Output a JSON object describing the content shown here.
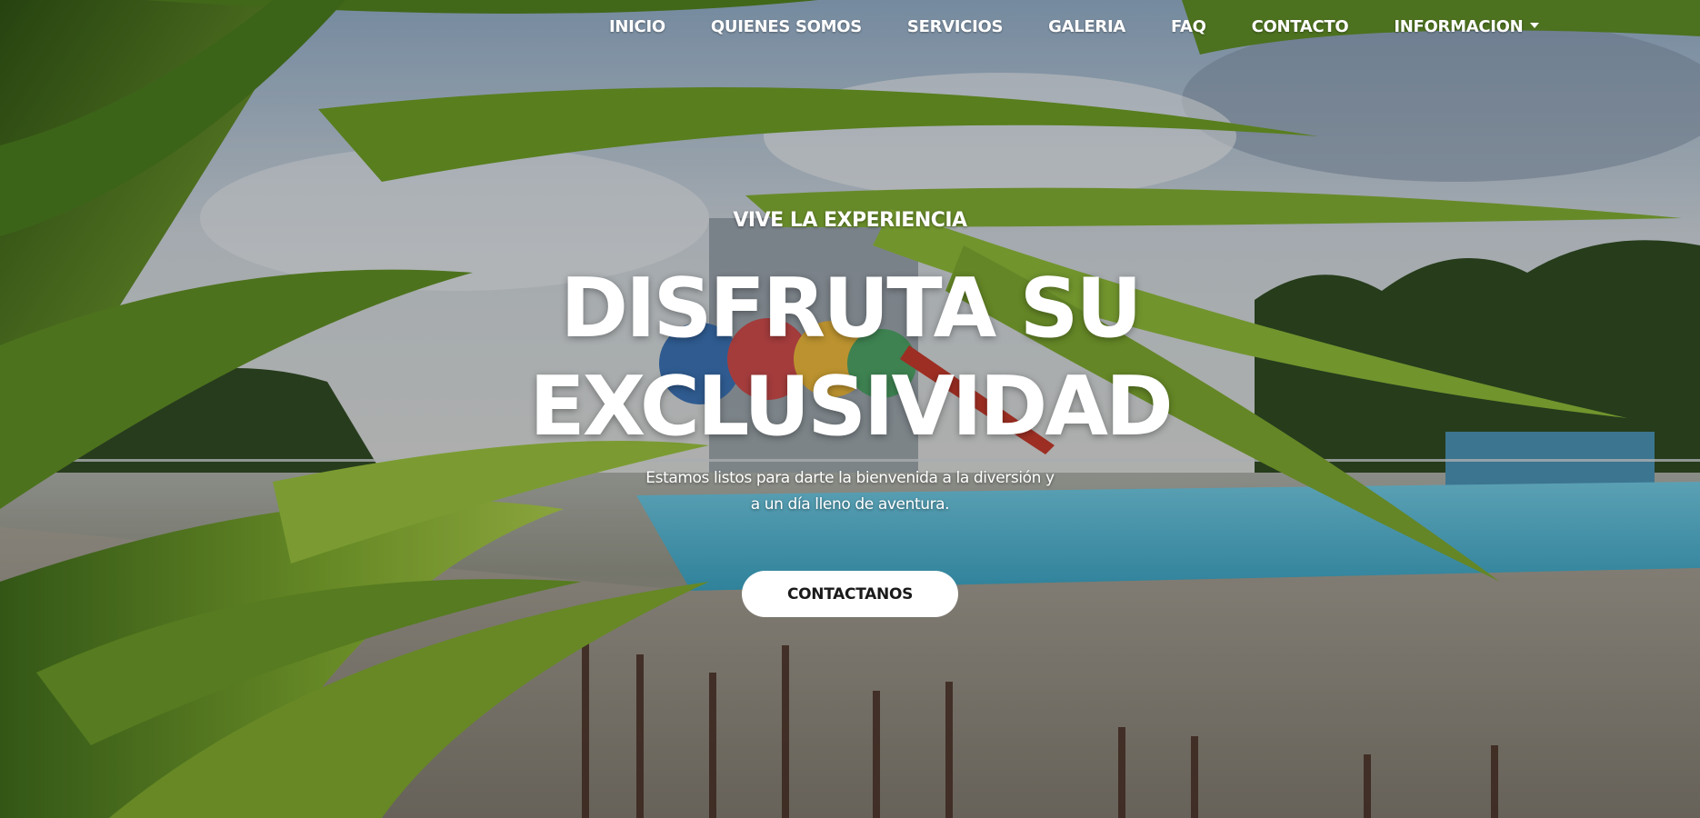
{
  "navbar": {
    "items": [
      {
        "label": "INICIO"
      },
      {
        "label": "QUIENES SOMOS"
      },
      {
        "label": "SERVICIOS"
      },
      {
        "label": "GALERIA"
      },
      {
        "label": "FAQ"
      },
      {
        "label": "CONTACTO"
      },
      {
        "label": "INFORMACION",
        "has_dropdown": true
      }
    ]
  },
  "hero": {
    "kicker": "VIVE LA EXPERIENCIA",
    "headline_line1": "DISFRUTA SU",
    "headline_line2": "EXCLUSIVIDAD",
    "subtitle_line1": "Estamos listos para darte la bienvenida a la diversión y",
    "subtitle_line2": "a un día lleno de aventura.",
    "cta_label": "CONTACTANOS",
    "background_image": "water park pool with slides framed by palm fronds"
  },
  "colors": {
    "text": "#ffffff",
    "button_bg": "#ffffff",
    "button_text": "#1a1a1a",
    "pool": "#4fb3cf",
    "foliage": "#6e9a2c"
  }
}
